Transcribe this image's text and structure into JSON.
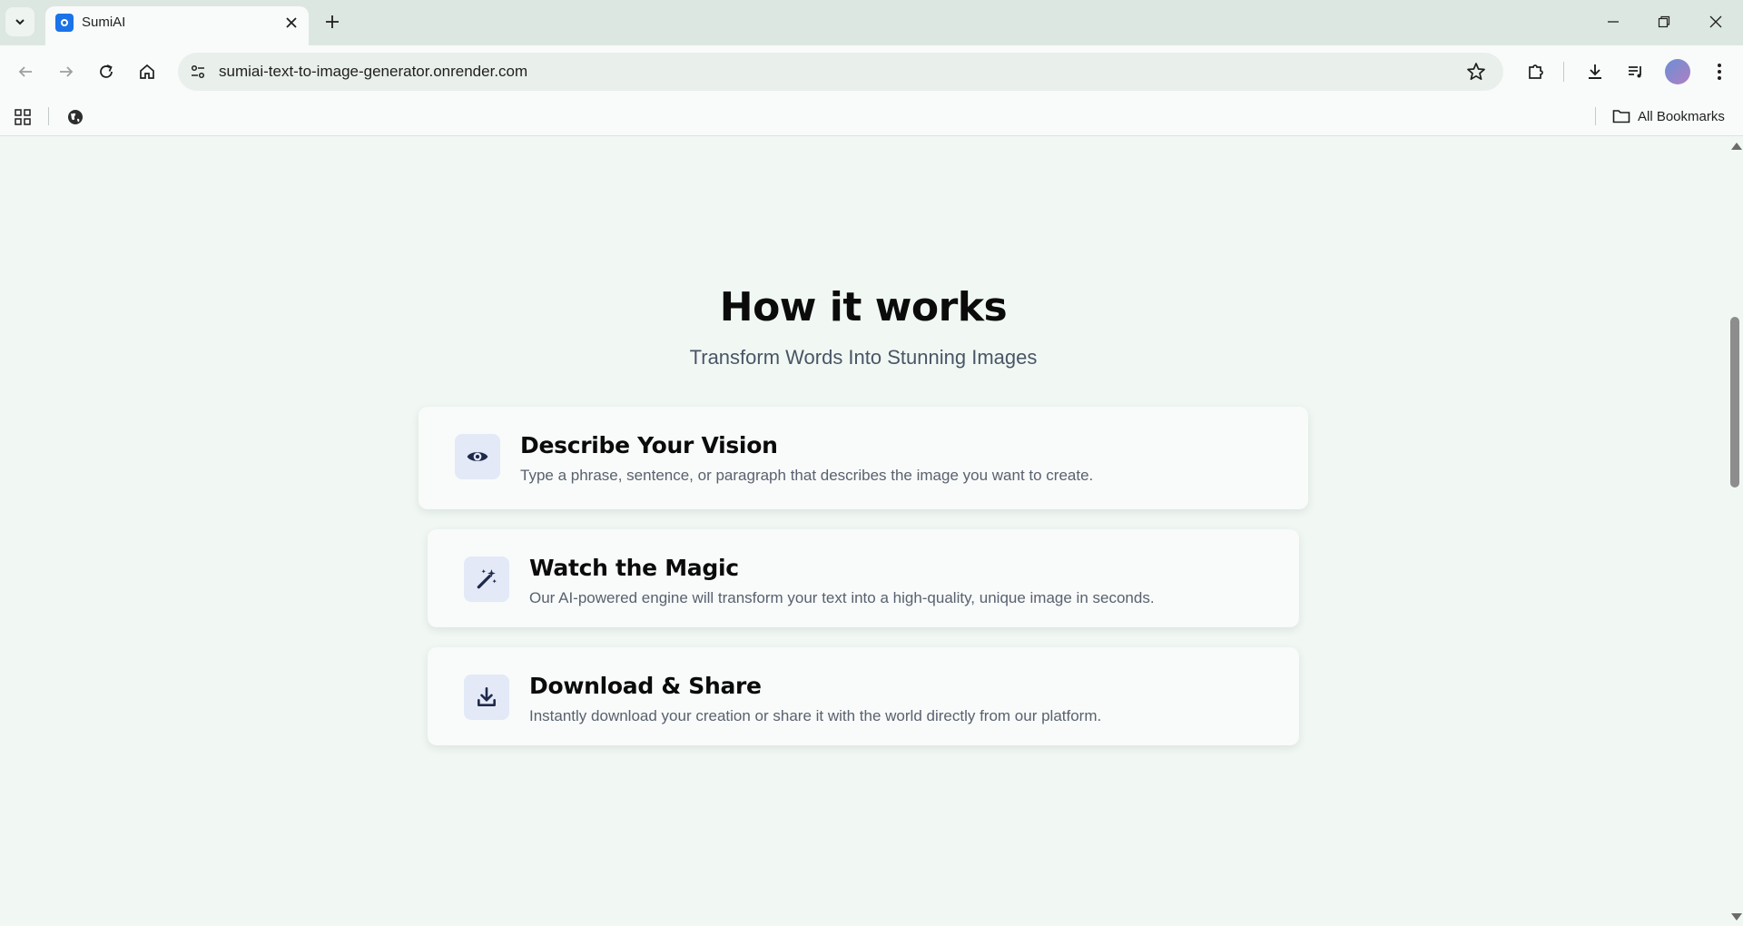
{
  "browser": {
    "tab": {
      "title": "SumiAI"
    },
    "address_bar": {
      "url": "sumiai-text-to-image-generator.onrender.com"
    },
    "bookmarks": {
      "all_bookmarks_label": "All Bookmarks"
    }
  },
  "page": {
    "section": {
      "title": "How it works",
      "subtitle": "Transform Words Into Stunning Images"
    },
    "steps": [
      {
        "icon": "eye-icon",
        "title": "Describe Your Vision",
        "description": "Type a phrase, sentence, or paragraph that describes the image you want to create."
      },
      {
        "icon": "magic-wand-icon",
        "title": "Watch the Magic",
        "description": "Our AI-powered engine will transform your text into a high-quality, unique image in seconds."
      },
      {
        "icon": "download-icon",
        "title": "Download & Share",
        "description": "Instantly download your creation or share it with the world directly from our platform."
      }
    ]
  },
  "colors": {
    "page_background": "#f1f8f4",
    "icon_tile": "#e3e9f7",
    "icon_color": "#1e2a4a"
  }
}
